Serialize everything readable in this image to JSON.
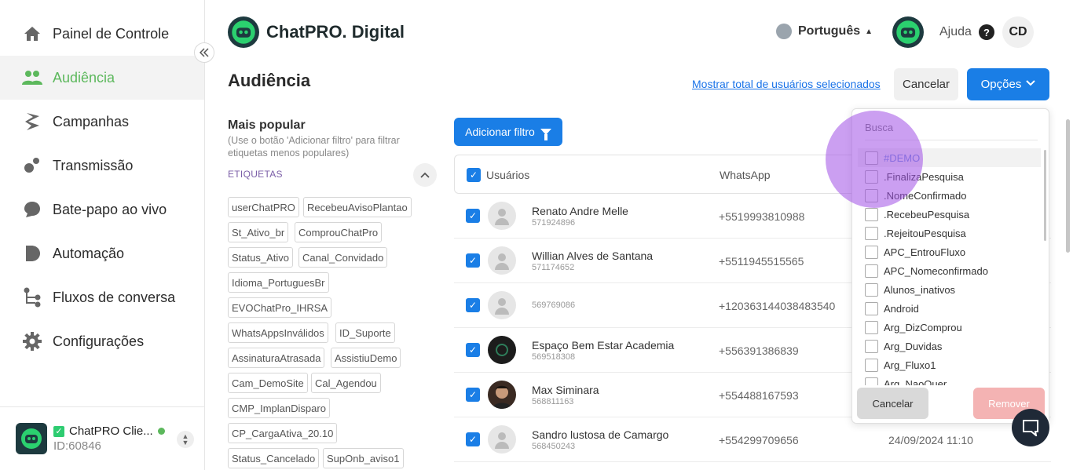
{
  "sidebar": {
    "items": [
      {
        "label": "Painel de Controle",
        "icon": "home-icon"
      },
      {
        "label": "Audiência",
        "icon": "users-icon"
      },
      {
        "label": "Campanhas",
        "icon": "campaign-icon"
      },
      {
        "label": "Transmissão",
        "icon": "broadcast-icon"
      },
      {
        "label": "Bate-papo ao vivo",
        "icon": "chat-icon"
      },
      {
        "label": "Automação",
        "icon": "automation-icon"
      },
      {
        "label": "Fluxos de conversa",
        "icon": "flow-icon"
      },
      {
        "label": "Configurações",
        "icon": "gear-icon"
      }
    ],
    "active_index": 1,
    "account": {
      "name": "ChatPRO Clie...",
      "id": "ID:60846"
    }
  },
  "header": {
    "brand": "ChatPRO. Digital",
    "language": "Português",
    "help": "Ajuda",
    "initials": "CD"
  },
  "page": {
    "title": "Audiência",
    "show_total": "Mostrar total de usuários selecionados",
    "cancel": "Cancelar",
    "options": "Opções"
  },
  "filters": {
    "heading": "Mais popular",
    "hint": "(Use o botão 'Adicionar filtro' para filtrar etiquetas menos populares)",
    "section": "ETIQUETAS",
    "tags": [
      "userChatPRO",
      "RecebeuAvisoPlantao",
      "St_Ativo_br",
      "ComprouChatPro",
      "Status_Ativo",
      "Canal_Convidado",
      "Idioma_PortuguesBr",
      "EVOChatPro_IHRSA",
      "WhatsAppsInválidos",
      "ID_Suporte",
      "AssinaturaAtrasada",
      "AssistiuDemo",
      "Cam_DemoSite",
      "Cal_Agendou",
      "CMP_ImplanDisparo",
      "CP_CargaAtiva_20.10",
      "Status_Cancelado",
      "SupOnb_aviso1"
    ]
  },
  "table": {
    "add_filter": "Adicionar filtro",
    "col_users": "Usuários",
    "col_whatsapp": "WhatsApp",
    "rows": [
      {
        "name": "Renato Andre Melle",
        "id": "571924896",
        "whatsapp": "+5519993810988",
        "date": "",
        "avatar": "default"
      },
      {
        "name": "Willian Alves de Santana",
        "id": "571174652",
        "whatsapp": "+5511945515565",
        "date": "",
        "avatar": "default"
      },
      {
        "name": "",
        "id": "569769086",
        "whatsapp": "+120363144038483540",
        "date": "",
        "avatar": "default"
      },
      {
        "name": "Espaço Bem Estar Academia",
        "id": "569518308",
        "whatsapp": "+556391386839",
        "date": "",
        "avatar": "dark"
      },
      {
        "name": "Max Siminara",
        "id": "568811163",
        "whatsapp": "+554488167593",
        "date": "",
        "avatar": "photo"
      },
      {
        "name": "Sandro lustosa de Camargo",
        "id": "568450243",
        "whatsapp": "+554299709656",
        "date": "24/09/2024 11:10",
        "avatar": "default"
      }
    ]
  },
  "dropdown": {
    "search_placeholder": "Busca",
    "items": [
      "#DEMO",
      ".FinalizaPesquisa",
      ".NomeConfirmado",
      ".RecebeuPesquisa",
      ".RejeitouPesquisa",
      "APC_EntrouFluxo",
      "APC_Nomeconfirmado",
      "Alunos_inativos",
      "Android",
      "Arg_DizComprou",
      "Arg_Duvidas",
      "Arg_Fluxo1",
      "Arg_NaoQuer"
    ],
    "cancel": "Cancelar",
    "remove": "Remover"
  },
  "colors": {
    "accent": "#1a7ee6",
    "active_nav": "#5cb85c",
    "tag_section": "#7b5ea7",
    "remove_disabled": "#f4b3b3"
  }
}
